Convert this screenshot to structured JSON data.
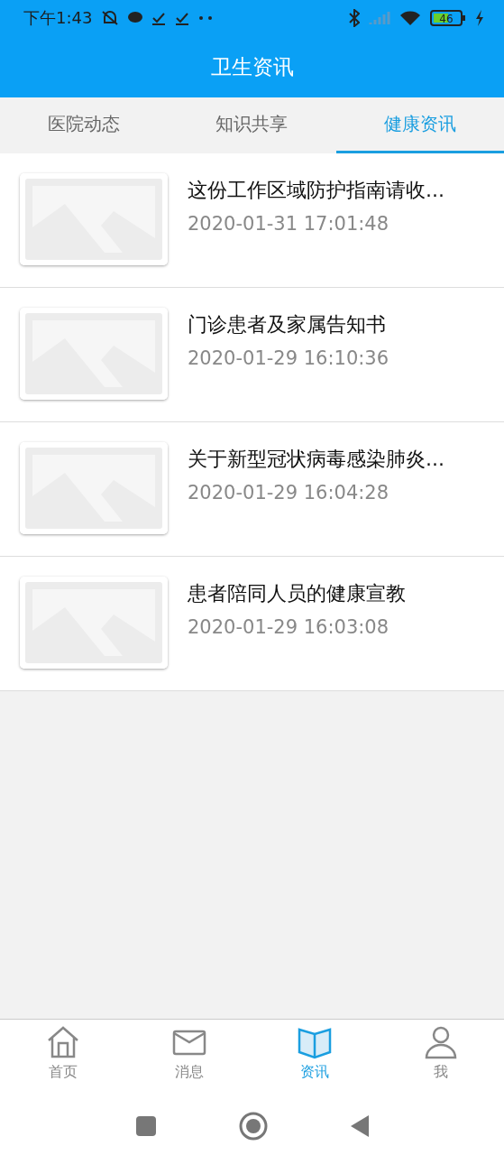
{
  "status_bar": {
    "time": "下午1:43",
    "battery": "46"
  },
  "header": {
    "title": "卫生资讯"
  },
  "tabs": [
    {
      "label": "医院动态",
      "selected": false
    },
    {
      "label": "知识共享",
      "selected": false
    },
    {
      "label": "健康资讯",
      "selected": true
    }
  ],
  "articles": [
    {
      "title": "这份工作区域防护指南请收...",
      "date": "2020-01-31 17:01:48"
    },
    {
      "title": "门诊患者及家属告知书",
      "date": "2020-01-29 16:10:36"
    },
    {
      "title": "关于新型冠状病毒感染肺炎...",
      "date": "2020-01-29 16:04:28"
    },
    {
      "title": "患者陪同人员的健康宣教",
      "date": "2020-01-29 16:03:08"
    }
  ],
  "bottom_nav": [
    {
      "kind": "home",
      "label": "首页",
      "selected": false
    },
    {
      "kind": "mail",
      "label": "消息",
      "selected": false
    },
    {
      "kind": "book",
      "label": "资讯",
      "selected": true
    },
    {
      "kind": "person",
      "label": "我",
      "selected": false
    }
  ]
}
